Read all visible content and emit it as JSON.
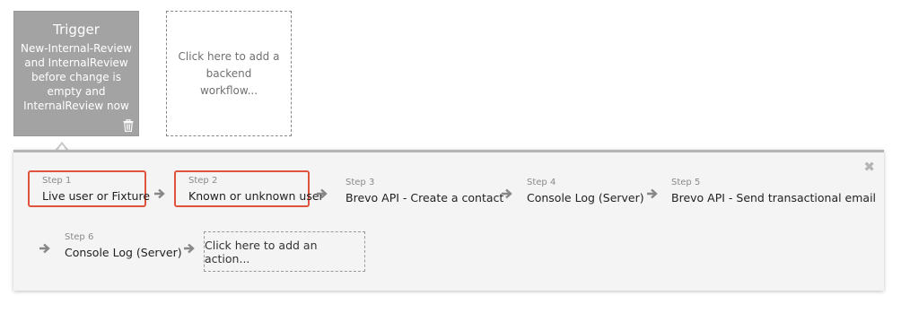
{
  "trigger": {
    "title": "Trigger",
    "description": "New-Internal-Review and InternalReview before change is empty and InternalReview now is"
  },
  "add_backend": {
    "label": "Click here to add a backend workflow..."
  },
  "steps": [
    {
      "number": "Step 1",
      "name": "Live user or Fixture",
      "highlighted": true
    },
    {
      "number": "Step 2",
      "name": "Known or unknown user",
      "highlighted": true
    },
    {
      "number": "Step 3",
      "name": "Brevo API - Create a contact",
      "highlighted": false
    },
    {
      "number": "Step 4",
      "name": "Console Log (Server)",
      "highlighted": false
    },
    {
      "number": "Step 5",
      "name": "Brevo API - Send transactional email",
      "highlighted": false
    },
    {
      "number": "Step 6",
      "name": "Console Log (Server)",
      "highlighted": false
    }
  ],
  "add_action": {
    "label": "Click here to add an action..."
  },
  "colors": {
    "highlight_border": "#e0533d",
    "trigger_bg": "#a3a3a3",
    "arrow": "#888888"
  },
  "icons": {
    "close": "close-icon",
    "trash": "trash-icon",
    "arrow": "arrow-right-icon"
  }
}
